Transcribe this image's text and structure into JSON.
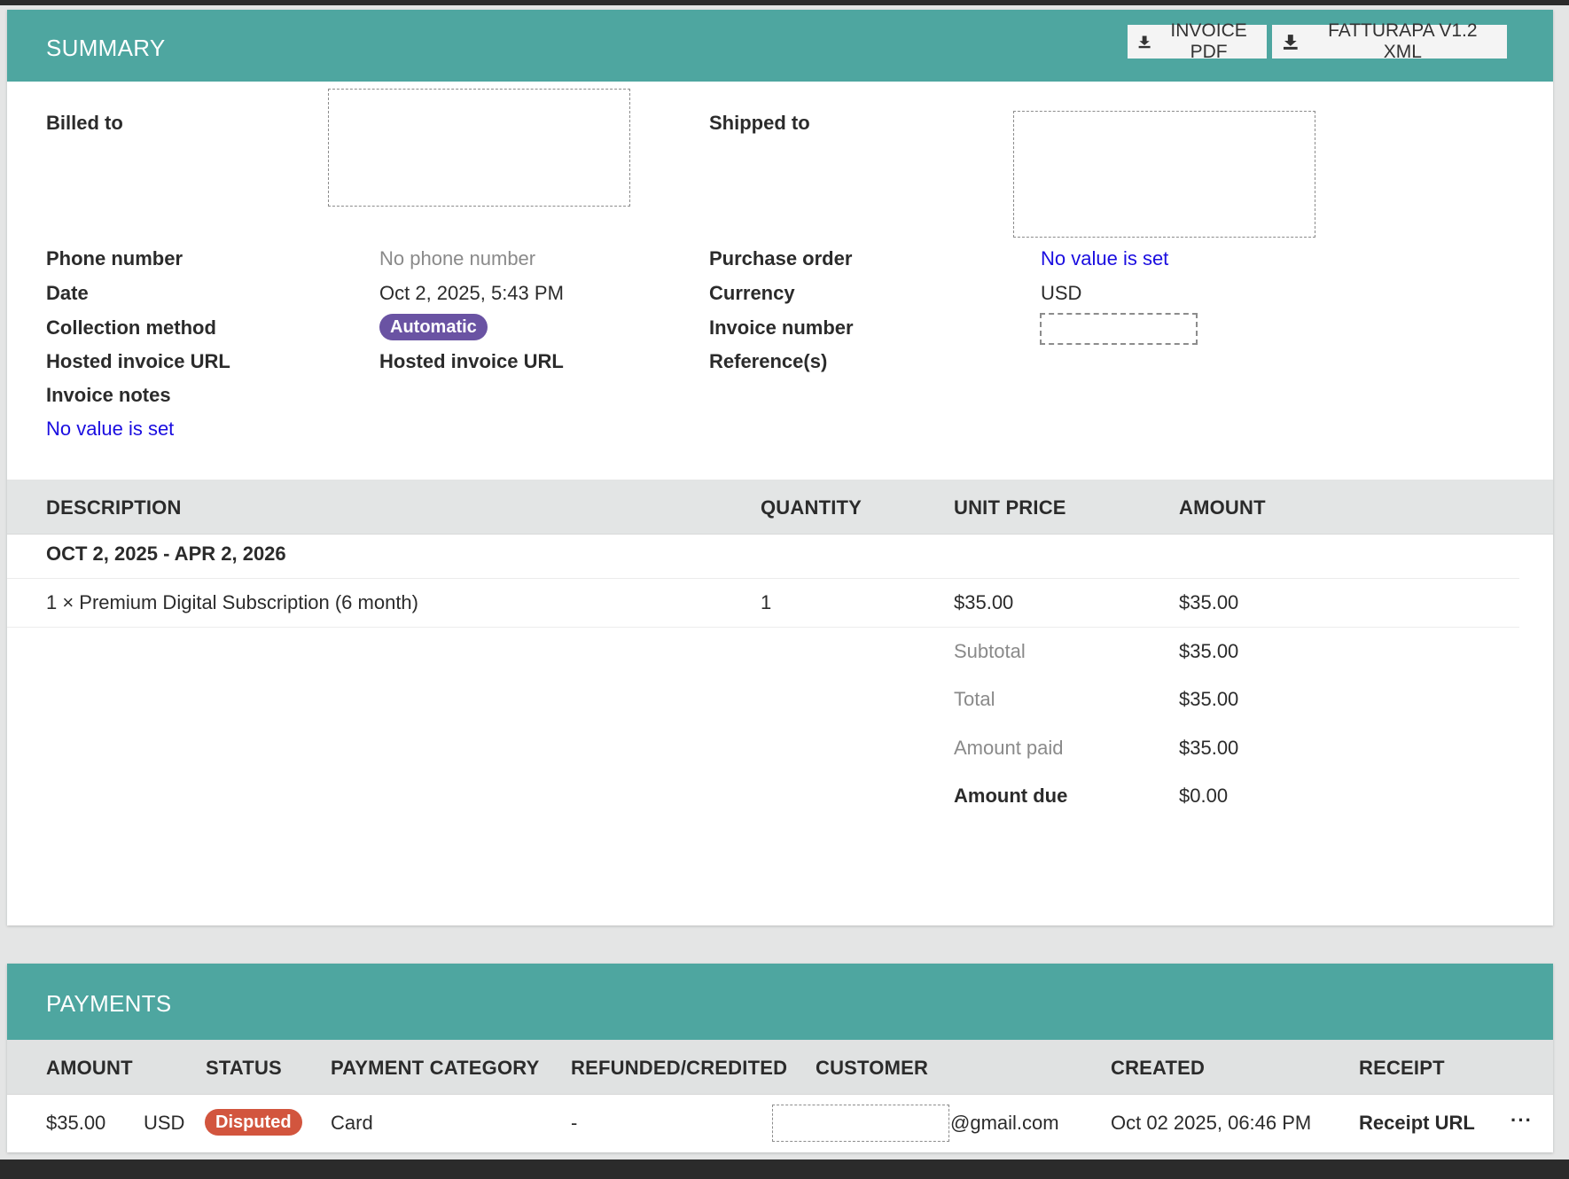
{
  "summary": {
    "title": "SUMMARY",
    "buttons": {
      "invoice_pdf": "INVOICE PDF",
      "fatturapa": "FATTURAPA V1.2 XML"
    },
    "fields": {
      "billed_to_label": "Billed to",
      "shipped_to_label": "Shipped to",
      "phone_label": "Phone number",
      "phone_value": "No phone number",
      "purchase_order_label": "Purchase order",
      "purchase_order_value": "No value is set",
      "date_label": "Date",
      "date_value": "Oct 2, 2025, 5:43 PM",
      "currency_label": "Currency",
      "currency_value": "USD",
      "collection_label": "Collection method",
      "collection_value": "Automatic",
      "invoice_number_label": "Invoice number",
      "hosted_url_label": "Hosted invoice URL",
      "hosted_url_value": "Hosted invoice URL",
      "references_label": "Reference(s)",
      "notes_label": "Invoice notes",
      "notes_value": "No value is set"
    },
    "table": {
      "headers": [
        "DESCRIPTION",
        "QUANTITY",
        "UNIT PRICE",
        "AMOUNT"
      ],
      "period": "OCT 2, 2025 - APR 2, 2026",
      "item": {
        "description": "1 × Premium Digital Subscription (6 month)",
        "quantity": "1",
        "unit_price": "$35.00",
        "amount": "$35.00"
      },
      "totals": [
        {
          "label": "Subtotal",
          "value": "$35.00"
        },
        {
          "label": "Total",
          "value": "$35.00"
        },
        {
          "label": "Amount paid",
          "value": "$35.00"
        },
        {
          "label": "Amount due",
          "value": "$0.00"
        }
      ]
    }
  },
  "payments": {
    "title": "PAYMENTS",
    "headers": [
      "AMOUNT",
      "STATUS",
      "PAYMENT CATEGORY",
      "REFUNDED/CREDITED",
      "CUSTOMER",
      "CREATED",
      "RECEIPT"
    ],
    "row": {
      "amount": "$35.00",
      "currency": "USD",
      "status": "Disputed",
      "category": "Card",
      "refunded": "-",
      "customer_suffix": "@gmail.com",
      "created": "Oct 02 2025, 06:46 PM",
      "receipt": "Receipt URL",
      "more": "···"
    }
  },
  "colors": {
    "header_teal": "#4ea6a0",
    "automatic_pill": "#6a53a3",
    "disputed_pill": "#d2553e",
    "link_blue": "#1a0de0"
  },
  "icons": {
    "download": "download-icon",
    "more": "more-horizontal-icon"
  }
}
